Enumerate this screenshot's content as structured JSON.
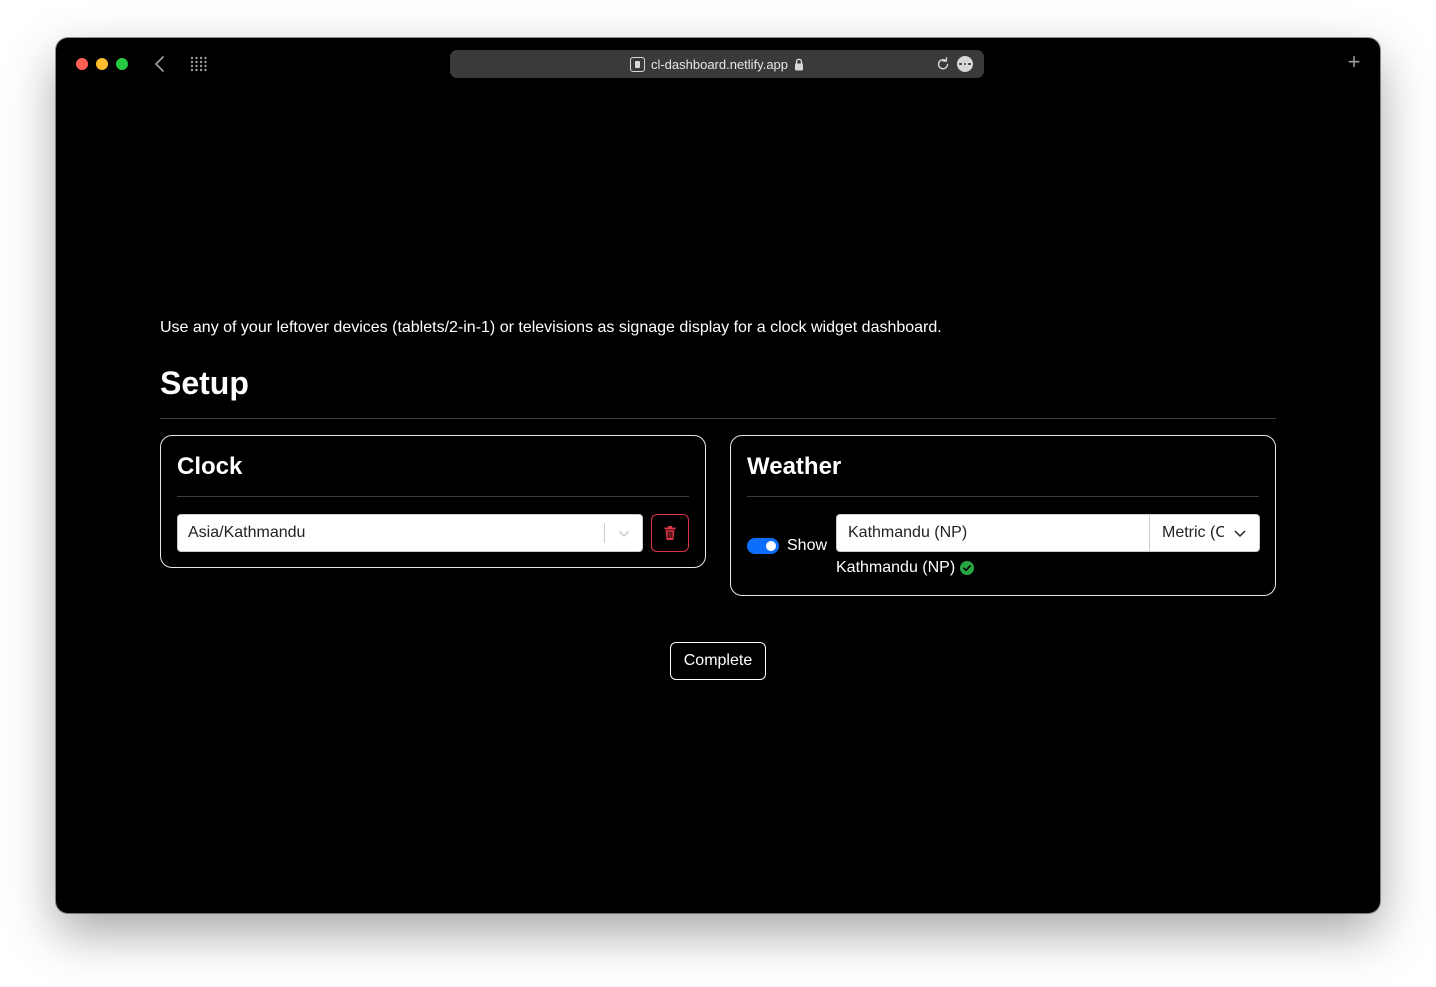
{
  "browser": {
    "url": "cl-dashboard.netlify.app"
  },
  "page": {
    "intro": "Use any of your leftover devices (tablets/2-in-1) or televisions as signage display for a clock widget dashboard.",
    "title": "Setup"
  },
  "clock": {
    "title": "Clock",
    "timezone": "Asia/Kathmandu"
  },
  "weather": {
    "title": "Weather",
    "show_label": "Show",
    "show_enabled": true,
    "location_value": "Kathmandu (NP)",
    "units": "Metric (C)",
    "resolved_location": "Kathmandu (NP)"
  },
  "actions": {
    "complete_label": "Complete"
  },
  "colors": {
    "toggle_on": "#0d6efd",
    "danger": "#dc3545",
    "success": "#28a745"
  }
}
